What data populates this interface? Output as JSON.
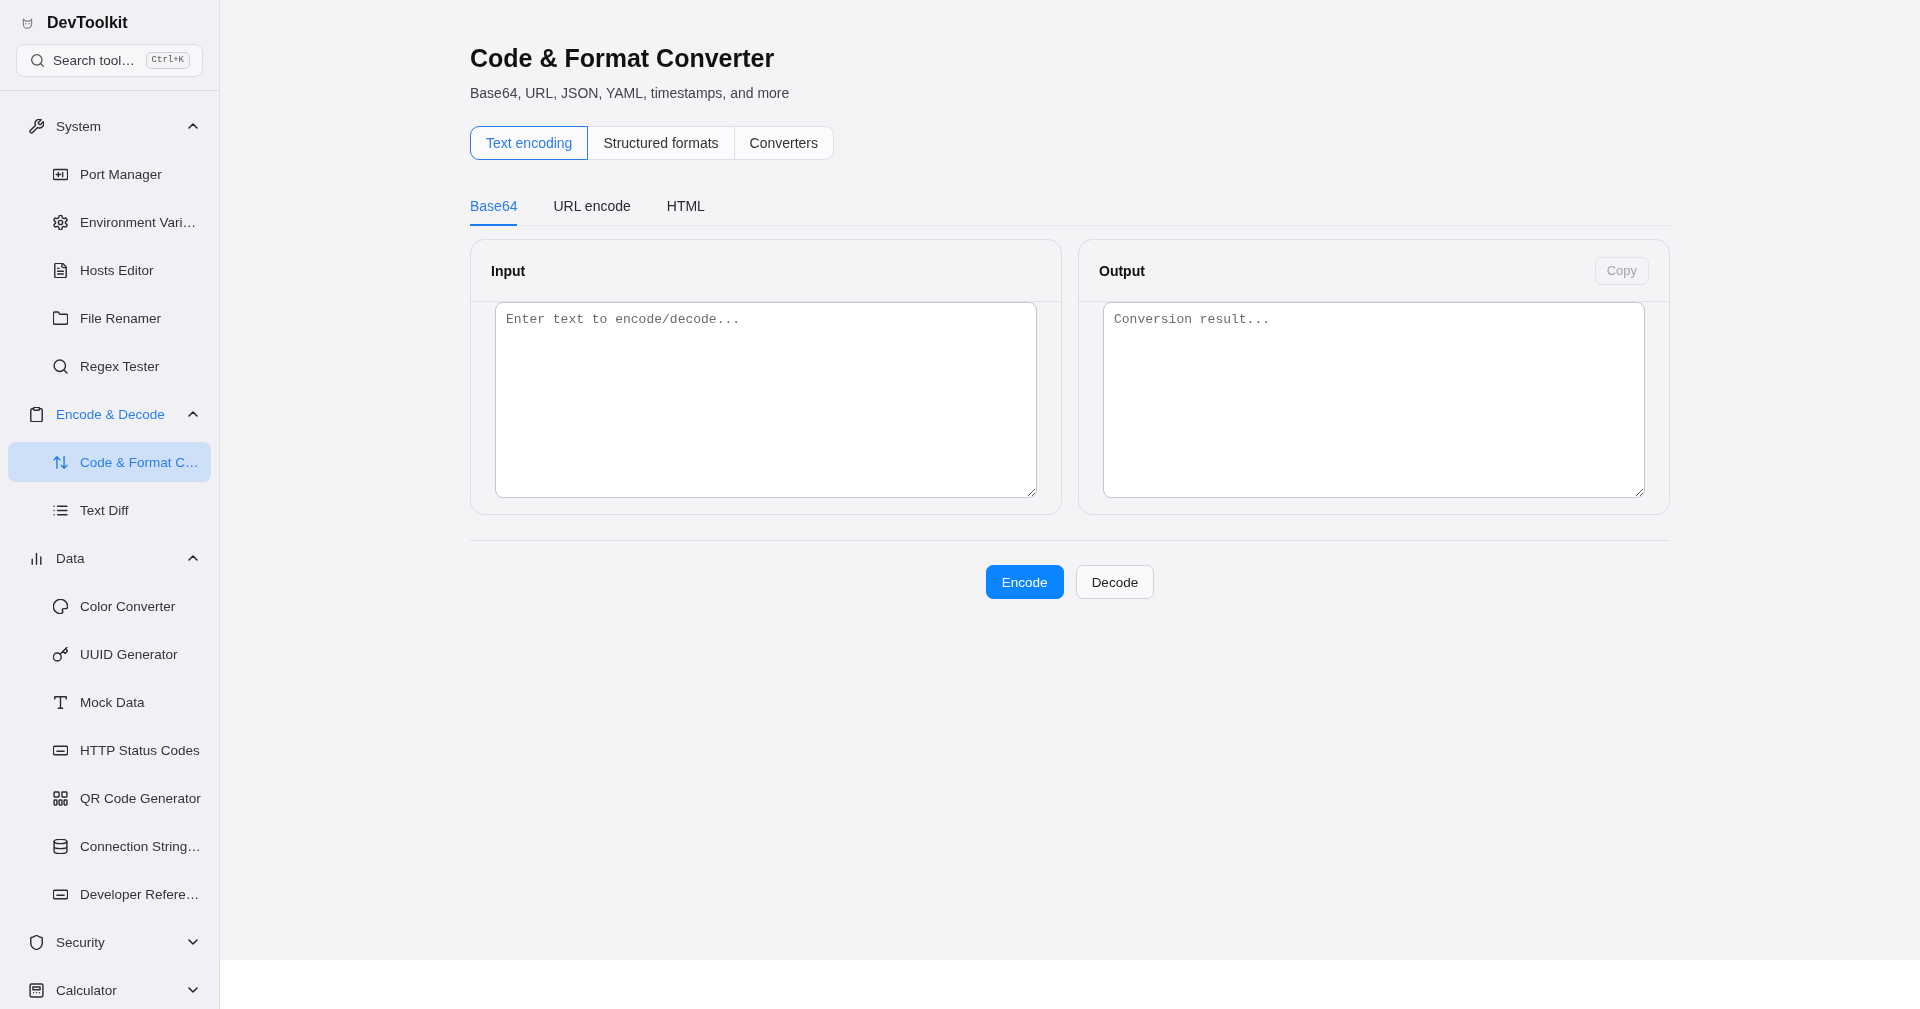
{
  "sidebar": {
    "app_name": "DevToolkit",
    "search": {
      "placeholder": "Search tool…",
      "shortcut": "Ctrl+K"
    },
    "groups": [
      {
        "label": "System",
        "expanded": true,
        "active": false,
        "children": [
          {
            "label": "Port Manager",
            "selected": false
          },
          {
            "label": "Environment Vari…",
            "selected": false
          },
          {
            "label": "Hosts Editor",
            "selected": false
          },
          {
            "label": "File Renamer",
            "selected": false
          },
          {
            "label": "Regex Tester",
            "selected": false
          }
        ]
      },
      {
        "label": "Encode & Decode",
        "expanded": true,
        "active": true,
        "children": [
          {
            "label": "Code & Format C…",
            "selected": true
          },
          {
            "label": "Text Diff",
            "selected": false
          }
        ]
      },
      {
        "label": "Data",
        "expanded": true,
        "active": false,
        "children": [
          {
            "label": "Color Converter",
            "selected": false
          },
          {
            "label": "UUID Generator",
            "selected": false
          },
          {
            "label": "Mock Data",
            "selected": false
          },
          {
            "label": "HTTP Status Codes",
            "selected": false
          },
          {
            "label": "QR Code Generator",
            "selected": false
          },
          {
            "label": "Connection String…",
            "selected": false
          },
          {
            "label": "Developer Refere…",
            "selected": false
          }
        ]
      },
      {
        "label": "Security",
        "expanded": false,
        "active": false
      },
      {
        "label": "Calculator",
        "expanded": false,
        "active": false
      }
    ]
  },
  "page": {
    "title": "Code & Format Converter",
    "subtitle": "Base64, URL, JSON, YAML, timestamps, and more"
  },
  "category_tabs": [
    {
      "label": "Text encoding",
      "selected": true
    },
    {
      "label": "Structured formats",
      "selected": false
    },
    {
      "label": "Converters",
      "selected": false
    }
  ],
  "format_tabs": [
    {
      "label": "Base64",
      "selected": true
    },
    {
      "label": "URL encode",
      "selected": false
    },
    {
      "label": "HTML",
      "selected": false
    }
  ],
  "input_panel": {
    "title": "Input",
    "placeholder": "Enter text to encode/decode..."
  },
  "output_panel": {
    "title": "Output",
    "placeholder": "Conversion result...",
    "copy_button": {
      "label": "Copy",
      "disabled": true
    }
  },
  "actions": [
    {
      "label": "Encode",
      "kind": "primary"
    },
    {
      "label": "Decode",
      "kind": "secondary"
    }
  ]
}
